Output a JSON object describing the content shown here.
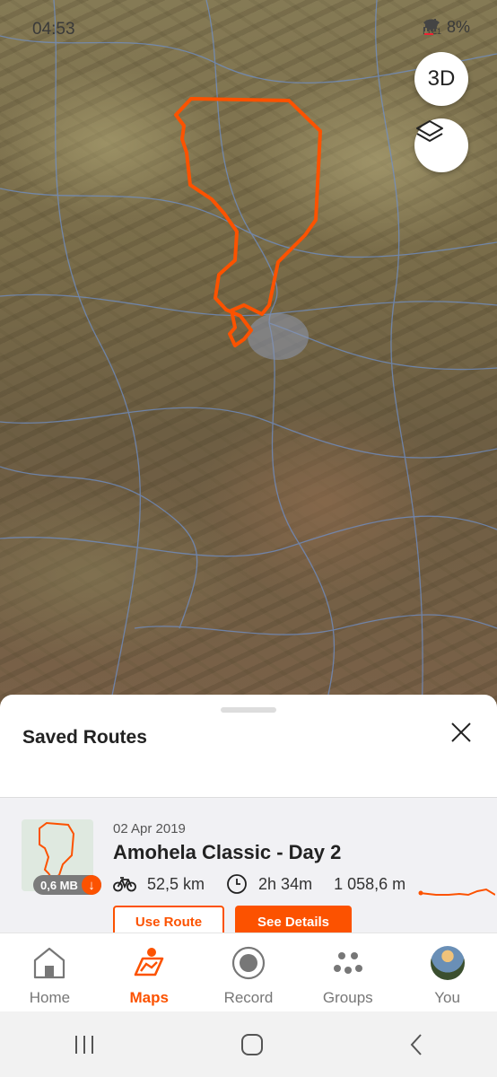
{
  "status_bar": {
    "time": "04:53",
    "network_top": "Vo)",
    "network_bottom": "LTE1",
    "battery": "8%"
  },
  "map": {
    "button_3d": "3D",
    "route_color": "#fc5200",
    "icons": [
      "layers-icon"
    ]
  },
  "sheet": {
    "title": "Saved Routes",
    "route": {
      "date": "02 Apr 2019",
      "name": "Amohela Classic - Day 2",
      "size": "0,6 MB",
      "distance": "52,5 km",
      "duration": "2h 34m",
      "elevation": "1 058,6 m",
      "use_route_label": "Use Route",
      "see_details_label": "See Details"
    }
  },
  "bottom_nav": {
    "items": [
      {
        "label": "Home",
        "icon": "home-icon"
      },
      {
        "label": "Maps",
        "icon": "maps-icon"
      },
      {
        "label": "Record",
        "icon": "record-icon"
      },
      {
        "label": "Groups",
        "icon": "groups-icon"
      },
      {
        "label": "You",
        "icon": "avatar"
      }
    ],
    "active": "Maps"
  },
  "system_nav": {
    "icons": [
      "recents-icon",
      "home-circle-icon",
      "back-icon"
    ]
  },
  "colors": {
    "accent": "#fc5200"
  }
}
